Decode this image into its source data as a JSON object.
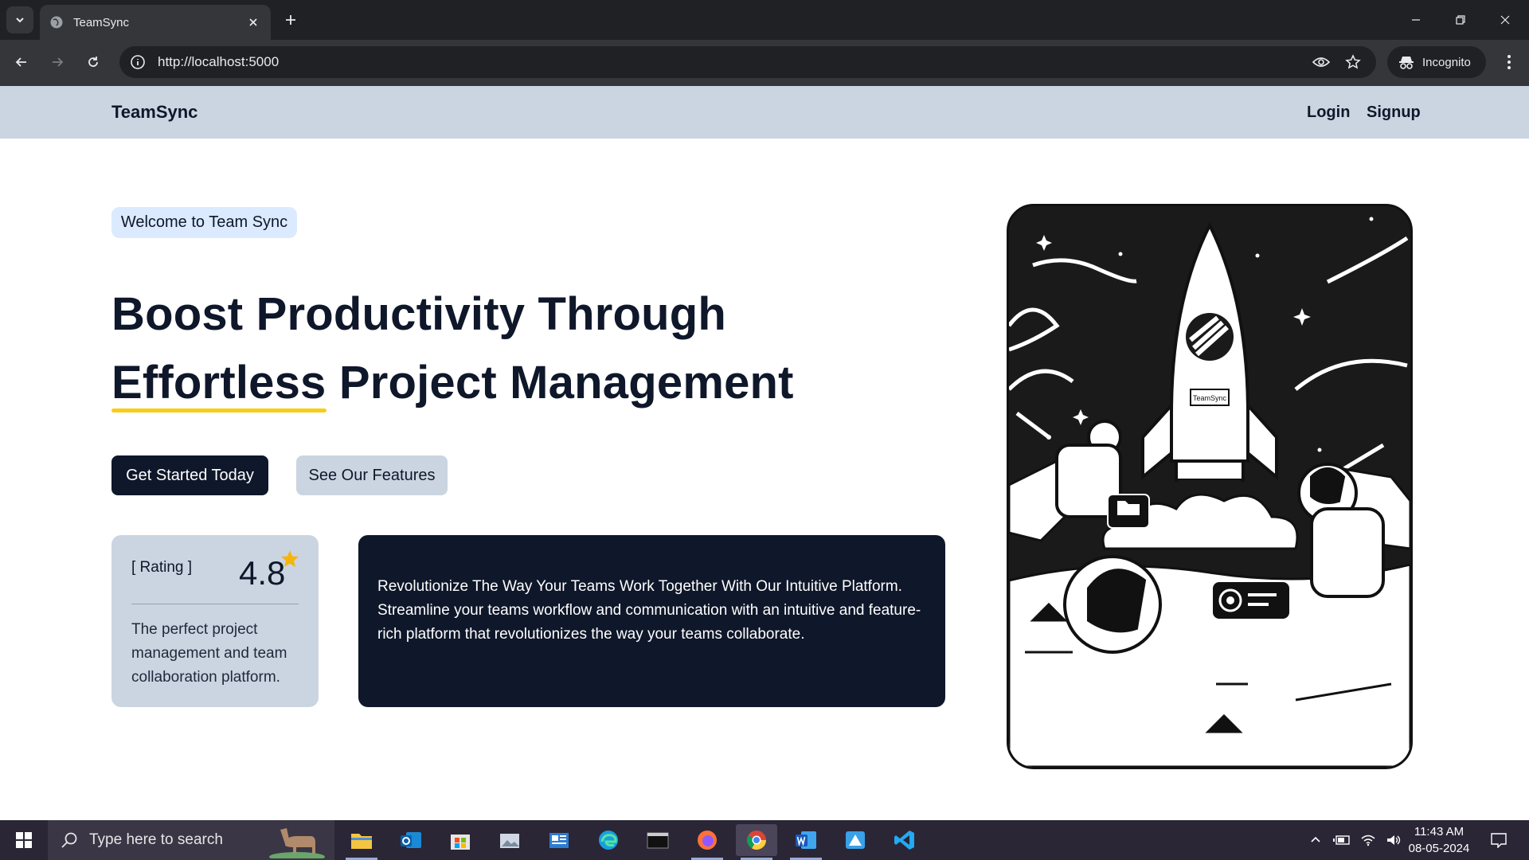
{
  "browser": {
    "tab_title": "TeamSync",
    "url": "http://localhost:5000",
    "incognito_label": "Incognito"
  },
  "site": {
    "brand": "TeamSync",
    "nav": {
      "login": "Login",
      "signup": "Signup"
    }
  },
  "hero": {
    "badge": "Welcome to Team Sync",
    "title_line1": "Boost Productivity Through",
    "title_highlight": "Effortless",
    "title_line2_rest": " Project Management",
    "cta_primary": "Get Started Today",
    "cta_secondary": "See Our Features"
  },
  "rating_card": {
    "label": "[ Rating ]",
    "value": "4.8",
    "description": "The perfect project management and team collaboration platform."
  },
  "info_card": {
    "text": "Revolutionize The Way Your Teams Work Together With Our Intuitive Platform. Streamline your teams workflow and communication with an intuitive and feature-rich platform that revolutionizes the way your teams collaborate."
  },
  "illustration": {
    "rocket_label": "TeamSync"
  },
  "taskbar": {
    "search_placeholder": "Type here to search",
    "time": "11:43 AM",
    "date": "08-05-2024",
    "apps": [
      "file-explorer",
      "outlook",
      "microsoft-store",
      "photos",
      "news",
      "edge",
      "terminal",
      "firefox",
      "chrome",
      "word",
      "paint",
      "vscode"
    ]
  },
  "colors": {
    "nav_bg": "#cbd5e1",
    "primary": "#0f172a",
    "badge_bg": "#dbeafe",
    "highlight": "#facc15",
    "star": "#f5b50a"
  }
}
